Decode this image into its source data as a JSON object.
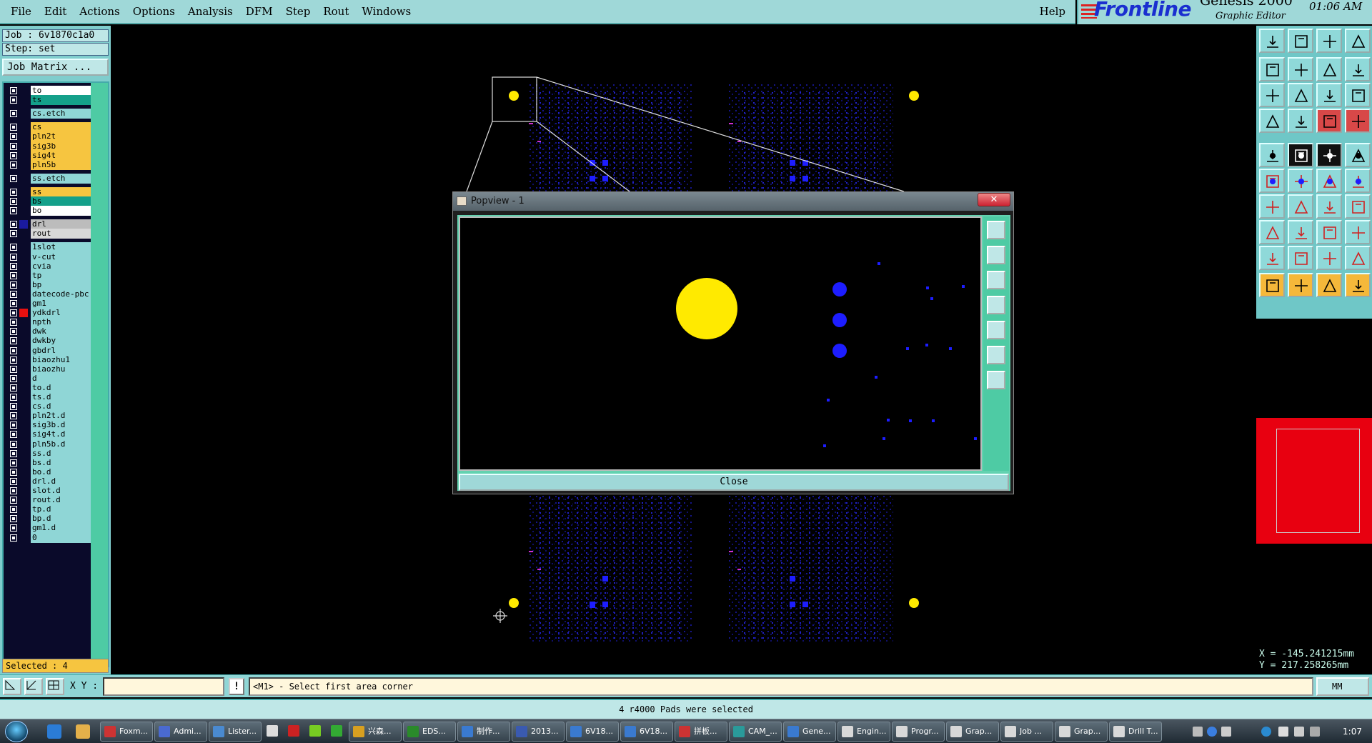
{
  "menu": [
    "File",
    "Edit",
    "Actions",
    "Options",
    "Analysis",
    "DFM",
    "Step",
    "Rout",
    "Windows"
  ],
  "help": "Help",
  "brand": {
    "logo": "Frontline",
    "product": "Genesis 2000",
    "subtitle": "Graphic Editor",
    "clock": "01:06 AM"
  },
  "job": "Job : 6v1870c1a0",
  "step": "Step: set",
  "job_matrix": "Job Matrix ...",
  "layers": [
    {
      "name": "to",
      "color": "#ffffff",
      "slot": ""
    },
    {
      "name": "ts",
      "color": "#14a08a",
      "slot": ""
    },
    {
      "name": "cs.etch",
      "color": "#8fd6d6",
      "slot": ""
    },
    {
      "name": "cs",
      "color": "#f6c540",
      "slot": ""
    },
    {
      "name": "pln2t",
      "color": "#f6c540",
      "slot": ""
    },
    {
      "name": "sig3b",
      "color": "#f6c540",
      "slot": ""
    },
    {
      "name": "sig4t",
      "color": "#f6c540",
      "slot": ""
    },
    {
      "name": "pln5b",
      "color": "#f6c540",
      "slot": ""
    },
    {
      "name": "ss.etch",
      "color": "#8fd6d6",
      "slot": ""
    },
    {
      "name": "ss",
      "color": "#f6c540",
      "slot": ""
    },
    {
      "name": "bs",
      "color": "#14a08a",
      "slot": ""
    },
    {
      "name": "bo",
      "color": "#ffffff",
      "slot": ""
    },
    {
      "name": "drl",
      "color": "#bcbcbc",
      "slot": "#1a1aa0"
    },
    {
      "name": "rout",
      "color": "#d8d8d8",
      "slot": ""
    },
    {
      "name": "1slot",
      "color": "#8fd6d6",
      "slot": ""
    },
    {
      "name": "v-cut",
      "color": "#8fd6d6",
      "slot": ""
    },
    {
      "name": "cvia",
      "color": "#8fd6d6",
      "slot": ""
    },
    {
      "name": "tp",
      "color": "#8fd6d6",
      "slot": ""
    },
    {
      "name": "bp",
      "color": "#8fd6d6",
      "slot": ""
    },
    {
      "name": "datecode-pbc",
      "color": "#8fd6d6",
      "slot": ""
    },
    {
      "name": "gm1",
      "color": "#8fd6d6",
      "slot": ""
    },
    {
      "name": "ydkdrl",
      "color": "#8fd6d6",
      "slot": "#e81010"
    },
    {
      "name": "npth",
      "color": "#8fd6d6",
      "slot": ""
    },
    {
      "name": "dwk",
      "color": "#8fd6d6",
      "slot": ""
    },
    {
      "name": "dwkby",
      "color": "#8fd6d6",
      "slot": ""
    },
    {
      "name": "gbdrl",
      "color": "#8fd6d6",
      "slot": ""
    },
    {
      "name": "biaozhu1",
      "color": "#8fd6d6",
      "slot": ""
    },
    {
      "name": "biaozhu",
      "color": "#8fd6d6",
      "slot": ""
    },
    {
      "name": "d",
      "color": "#8fd6d6",
      "slot": ""
    },
    {
      "name": "to.d",
      "color": "#8fd6d6",
      "slot": ""
    },
    {
      "name": "ts.d",
      "color": "#8fd6d6",
      "slot": ""
    },
    {
      "name": "cs.d",
      "color": "#8fd6d6",
      "slot": ""
    },
    {
      "name": "pln2t.d",
      "color": "#8fd6d6",
      "slot": ""
    },
    {
      "name": "sig3b.d",
      "color": "#8fd6d6",
      "slot": ""
    },
    {
      "name": "sig4t.d",
      "color": "#8fd6d6",
      "slot": ""
    },
    {
      "name": "pln5b.d",
      "color": "#8fd6d6",
      "slot": ""
    },
    {
      "name": "ss.d",
      "color": "#8fd6d6",
      "slot": ""
    },
    {
      "name": "bs.d",
      "color": "#8fd6d6",
      "slot": ""
    },
    {
      "name": "bo.d",
      "color": "#8fd6d6",
      "slot": ""
    },
    {
      "name": "drl.d",
      "color": "#8fd6d6",
      "slot": ""
    },
    {
      "name": "slot.d",
      "color": "#8fd6d6",
      "slot": ""
    },
    {
      "name": "rout.d",
      "color": "#8fd6d6",
      "slot": ""
    },
    {
      "name": "tp.d",
      "color": "#8fd6d6",
      "slot": ""
    },
    {
      "name": "bp.d",
      "color": "#8fd6d6",
      "slot": ""
    },
    {
      "name": "gm1.d",
      "color": "#8fd6d6",
      "slot": ""
    },
    {
      "name": "0",
      "color": "#8fd6d6",
      "slot": ""
    }
  ],
  "selected": "Selected : 4",
  "coords": {
    "x": "X = -145.241215mm",
    "y": "Y =  217.258265mm"
  },
  "xy_label": "X Y :",
  "xy_value": "",
  "prompt": "<M1> - Select first area corner",
  "units": "MM",
  "status": "4 r4000 Pads were selected",
  "popview": {
    "title": "Popview - 1",
    "close_x": "✕",
    "close_button": "Close"
  },
  "taskbar": {
    "tasks": [
      "Foxm...",
      "Admi...",
      "Lister...",
      "",
      "",
      "",
      "",
      "兴森...",
      "EDS...",
      "制作...",
      "2013...",
      "6V18...",
      "6V18...",
      "拼板...",
      "CAM_...",
      "Gene...",
      "Engin...",
      "Progr...",
      "Grap...",
      "Job ...",
      "Grap...",
      "Drill T..."
    ],
    "clock": "1:07"
  },
  "colors": {
    "panel": "#7fcdcd",
    "accent_yellow": "#ffea00",
    "pad_blue": "#1d1dff",
    "overview_red": "#e80010"
  }
}
